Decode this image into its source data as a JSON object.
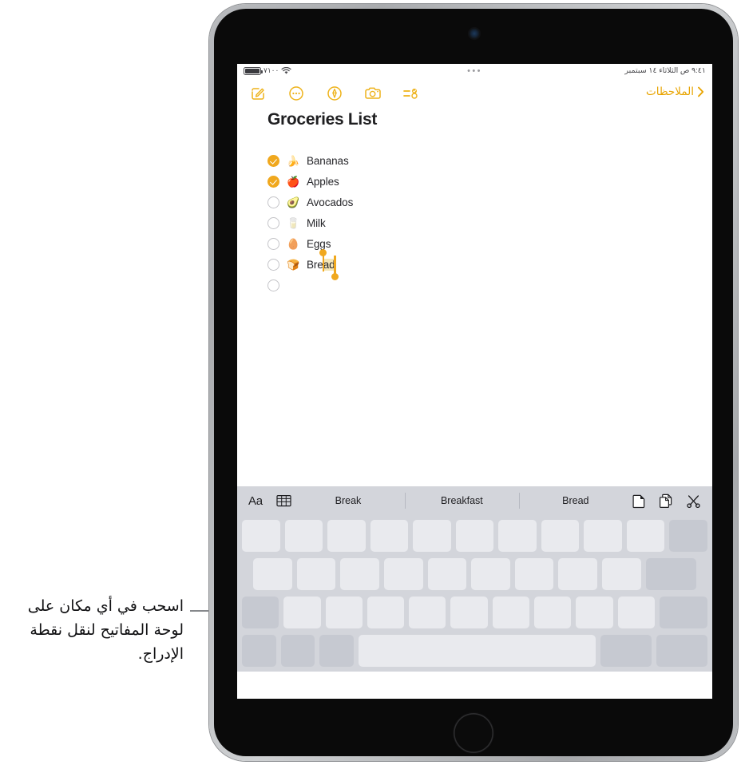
{
  "device": {
    "name": "ipad",
    "camera": "front-camera",
    "home_button": "home-button"
  },
  "statusbar": {
    "battery_percent": "٧١٠٠",
    "wifi_icon": "wifi-icon",
    "center_dots": "•••",
    "datetime": "٩:٤١ ص الثلاثاء ١٤ سبتمبر"
  },
  "toolbar": {
    "icons": [
      {
        "name": "compose-icon",
        "label": "Compose"
      },
      {
        "name": "more-icon",
        "label": "More"
      },
      {
        "name": "markup-icon",
        "label": "Markup"
      },
      {
        "name": "camera-icon",
        "label": "Camera"
      },
      {
        "name": "checklist-icon",
        "label": "Checklist"
      }
    ],
    "back_label": "الملاحظات",
    "back_icon": "chevron-right-icon",
    "accent_color": "#e8a400"
  },
  "note": {
    "title": "Groceries List",
    "items": [
      {
        "emoji": "🍌",
        "text": "Bananas",
        "checked": true
      },
      {
        "emoji": "🍎",
        "text": "Apples",
        "checked": true
      },
      {
        "emoji": "🥑",
        "text": "Avocados",
        "checked": false
      },
      {
        "emoji": "🥛",
        "text": "Milk",
        "checked": false
      },
      {
        "emoji": "🥚",
        "text": "Eggs",
        "checked": false
      },
      {
        "emoji": "🍞",
        "text": "Bread",
        "checked": false,
        "selection": {
          "prefix": "Bre",
          "selected": "ad"
        }
      },
      {
        "emoji": "",
        "text": "",
        "checked": false
      }
    ]
  },
  "predictive_bar": {
    "format_label": "Aa",
    "table_icon": "table-icon",
    "suggestions": [
      "Break",
      "Breakfast",
      "Bread"
    ],
    "actions": [
      {
        "name": "paste-icon",
        "label": "Paste"
      },
      {
        "name": "copy-icon",
        "label": "Copy"
      },
      {
        "name": "cut-icon",
        "label": "Cut"
      }
    ],
    "background_color": "#d3d5db"
  },
  "keyboard": {
    "background_color": "#d3d5db",
    "key_color": "#e9eaee",
    "modifier_key_color": "#c6c9d1",
    "rows": [
      {
        "keys": [
          {
            "w": "1",
            "dark": false
          },
          {
            "w": "1",
            "dark": false
          },
          {
            "w": "1",
            "dark": false
          },
          {
            "w": "1",
            "dark": false
          },
          {
            "w": "1",
            "dark": false
          },
          {
            "w": "1",
            "dark": false
          },
          {
            "w": "1",
            "dark": false
          },
          {
            "w": "1",
            "dark": false
          },
          {
            "w": "1",
            "dark": false
          },
          {
            "w": "1",
            "dark": false
          },
          {
            "w": "1",
            "dark": true
          }
        ]
      },
      {
        "keys": [
          {
            "w": "1",
            "dark": false
          },
          {
            "w": "1",
            "dark": false
          },
          {
            "w": "1",
            "dark": false
          },
          {
            "w": "1",
            "dark": false
          },
          {
            "w": "1",
            "dark": false
          },
          {
            "w": "1",
            "dark": false
          },
          {
            "w": "1",
            "dark": false
          },
          {
            "w": "1",
            "dark": false
          },
          {
            "w": "1",
            "dark": false
          },
          {
            "w": "1.3",
            "dark": true
          }
        ]
      },
      {
        "keys": [
          {
            "w": "1",
            "dark": true
          },
          {
            "w": "1",
            "dark": false
          },
          {
            "w": "1",
            "dark": false
          },
          {
            "w": "1",
            "dark": false
          },
          {
            "w": "1",
            "dark": false
          },
          {
            "w": "1",
            "dark": false
          },
          {
            "w": "1",
            "dark": false
          },
          {
            "w": "1",
            "dark": false
          },
          {
            "w": "1",
            "dark": false
          },
          {
            "w": "1",
            "dark": false
          },
          {
            "w": "1.3",
            "dark": true
          }
        ]
      },
      {
        "keys": [
          {
            "w": "1",
            "dark": true
          },
          {
            "w": "1",
            "dark": true
          },
          {
            "w": "1",
            "dark": true
          },
          {
            "w": "7",
            "dark": false
          },
          {
            "w": "1.5",
            "dark": true
          },
          {
            "w": "1.5",
            "dark": true
          }
        ]
      }
    ]
  },
  "callout": {
    "text": "اسحب في أي مكان على لوحة المفاتيح لنقل نقطة الإدراج.",
    "leader_color": "#86888c"
  }
}
